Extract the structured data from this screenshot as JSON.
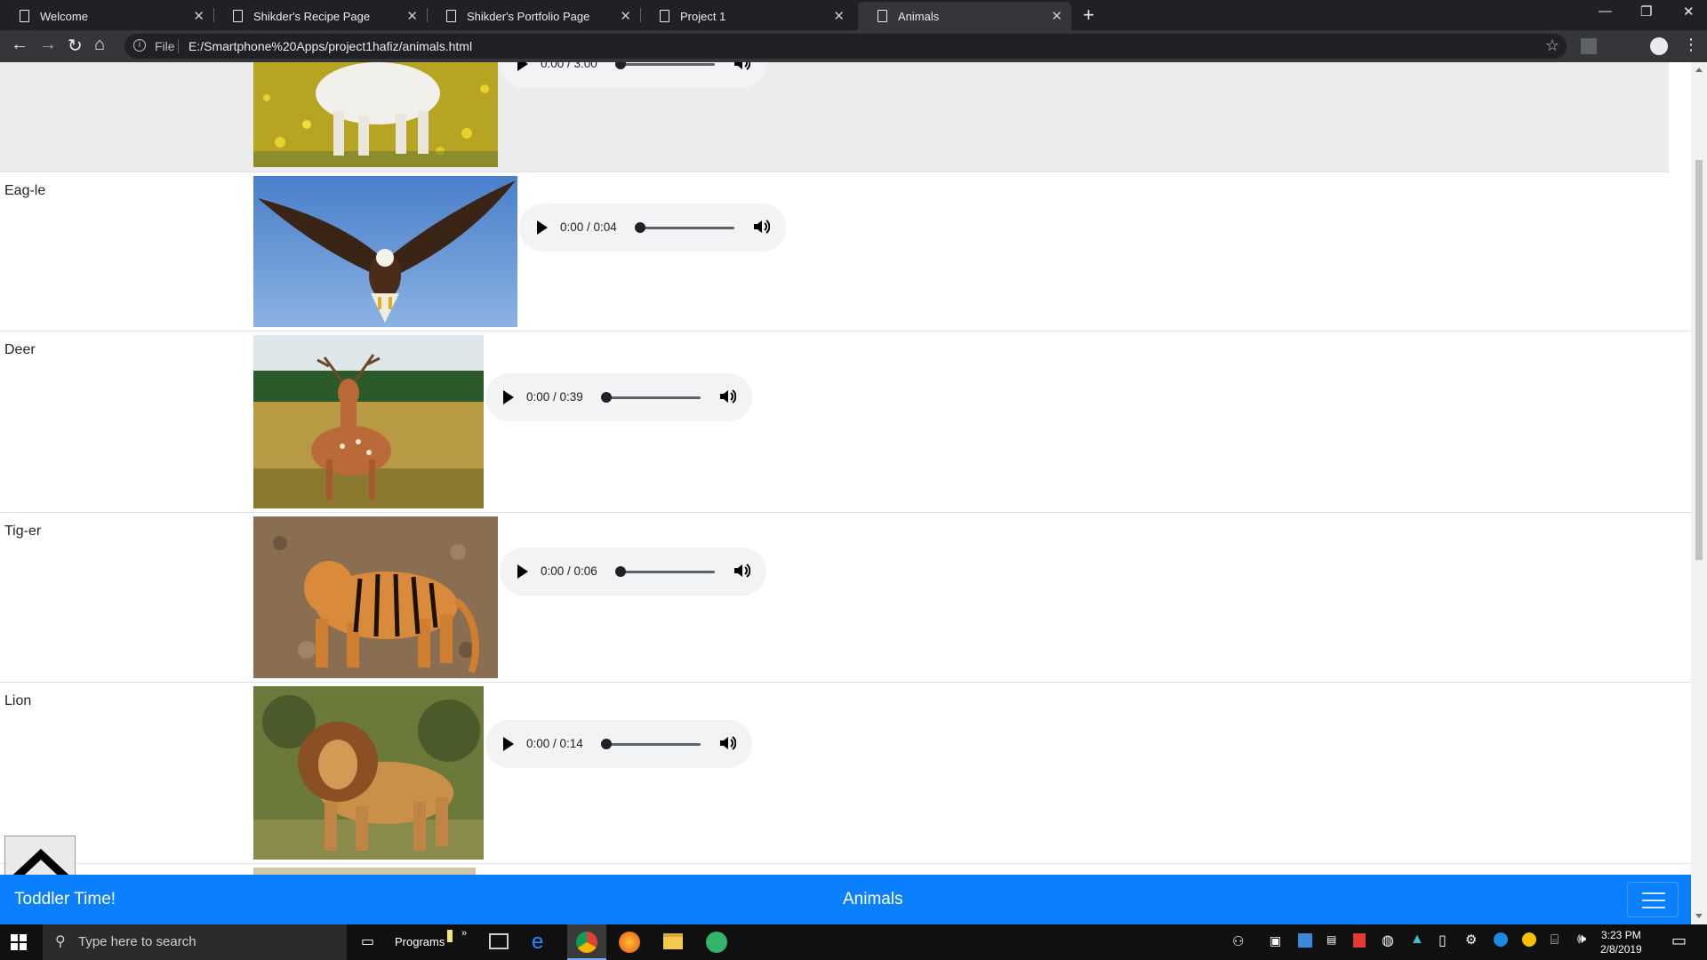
{
  "browser": {
    "tabs": [
      {
        "title": "Welcome"
      },
      {
        "title": "Shikder's Recipe Page"
      },
      {
        "title": "Shikder's Portfolio Page"
      },
      {
        "title": "Project 1"
      },
      {
        "title": "Animals"
      }
    ],
    "active_tab_index": 4,
    "address": {
      "scheme_label": "File",
      "url": "E:/Smartphone%20Apps/project1hafiz/animals.html"
    }
  },
  "page": {
    "animals": [
      {
        "name": "",
        "time": "0:00 / 3:00"
      },
      {
        "name": "Eag-le",
        "time": "0:00 / 0:04"
      },
      {
        "name": "Deer",
        "time": "0:00 / 0:39"
      },
      {
        "name": "Tig-er",
        "time": "0:00 / 0:06"
      },
      {
        "name": "Lion",
        "time": "0:00 / 0:14"
      }
    ],
    "navbar": {
      "brand": "Toddler Time!",
      "title": "Animals"
    }
  },
  "taskbar": {
    "search_placeholder": "Type here to search",
    "programs_label": "Programs",
    "time": "3:23 PM",
    "date": "2/8/2019"
  },
  "colors": {
    "navbar": "#0a80ff",
    "tabbar": "#202124"
  }
}
